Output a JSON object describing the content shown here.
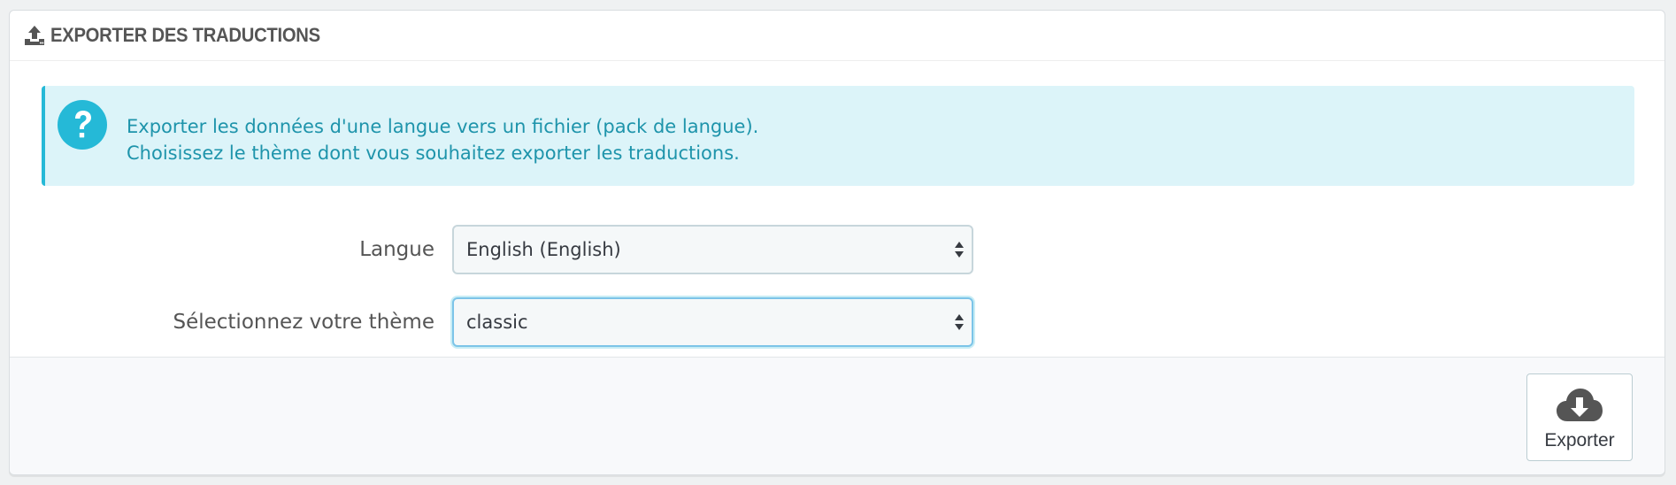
{
  "panel": {
    "title": "EXPORTER DES TRADUCTIONS",
    "title_icon": "upload-icon"
  },
  "alert": {
    "icon": "question-circle-icon",
    "line1": "Exporter les données d'une langue vers un fichier (pack de langue).",
    "line2": "Choisissez le thème dont vous souhaitez exporter les traductions.",
    "color": "#1e94ab",
    "background": "#dcf4f9",
    "accent": "#25b9d7"
  },
  "form": {
    "language": {
      "label": "Langue",
      "value": "English (English)"
    },
    "theme": {
      "label": "Sélectionnez votre thème",
      "value": "classic"
    }
  },
  "footer": {
    "export_button": {
      "label": "Exporter",
      "icon": "cloud-download-icon"
    }
  }
}
